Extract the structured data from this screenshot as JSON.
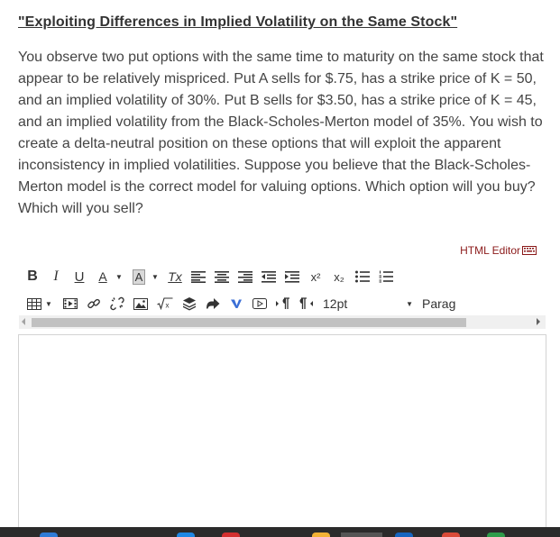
{
  "question": {
    "title": "\"Exploiting Differences in Implied Volatility on the Same Stock\"",
    "body": "You observe two put options with the same time to maturity on the same stock that appear to be relatively mispriced. Put A sells for $.75, has a strike price of K = 50, and an implied volatility of 30%. Put B sells for $3.50, has a strike price of K = 45, and an implied volatility from the Black-Scholes-Merton model of 35%. You wish to create a delta-neutral position on these options that will exploit the apparent inconsistency in implied volatilities. Suppose you believe that the Black-Scholes-Merton model is the correct model for valuing options. Which option will you buy? Which will you sell?"
  },
  "editor": {
    "html_editor_label": "HTML Editor",
    "toolbar1": {
      "bold": "B",
      "italic": "I",
      "underline": "U",
      "font_color": "A",
      "bg_color": "A",
      "clear_format": "Tx",
      "superscript": "x²",
      "subscript": "x₂"
    },
    "toolbar2": {
      "font_size": "12pt",
      "paragraph": "Parag"
    },
    "content": ""
  },
  "colors": {
    "html_editor_link": "#8b1a1a",
    "vimeo_icon": "#3b6fd6",
    "taskbar": "#2b2b2b"
  }
}
